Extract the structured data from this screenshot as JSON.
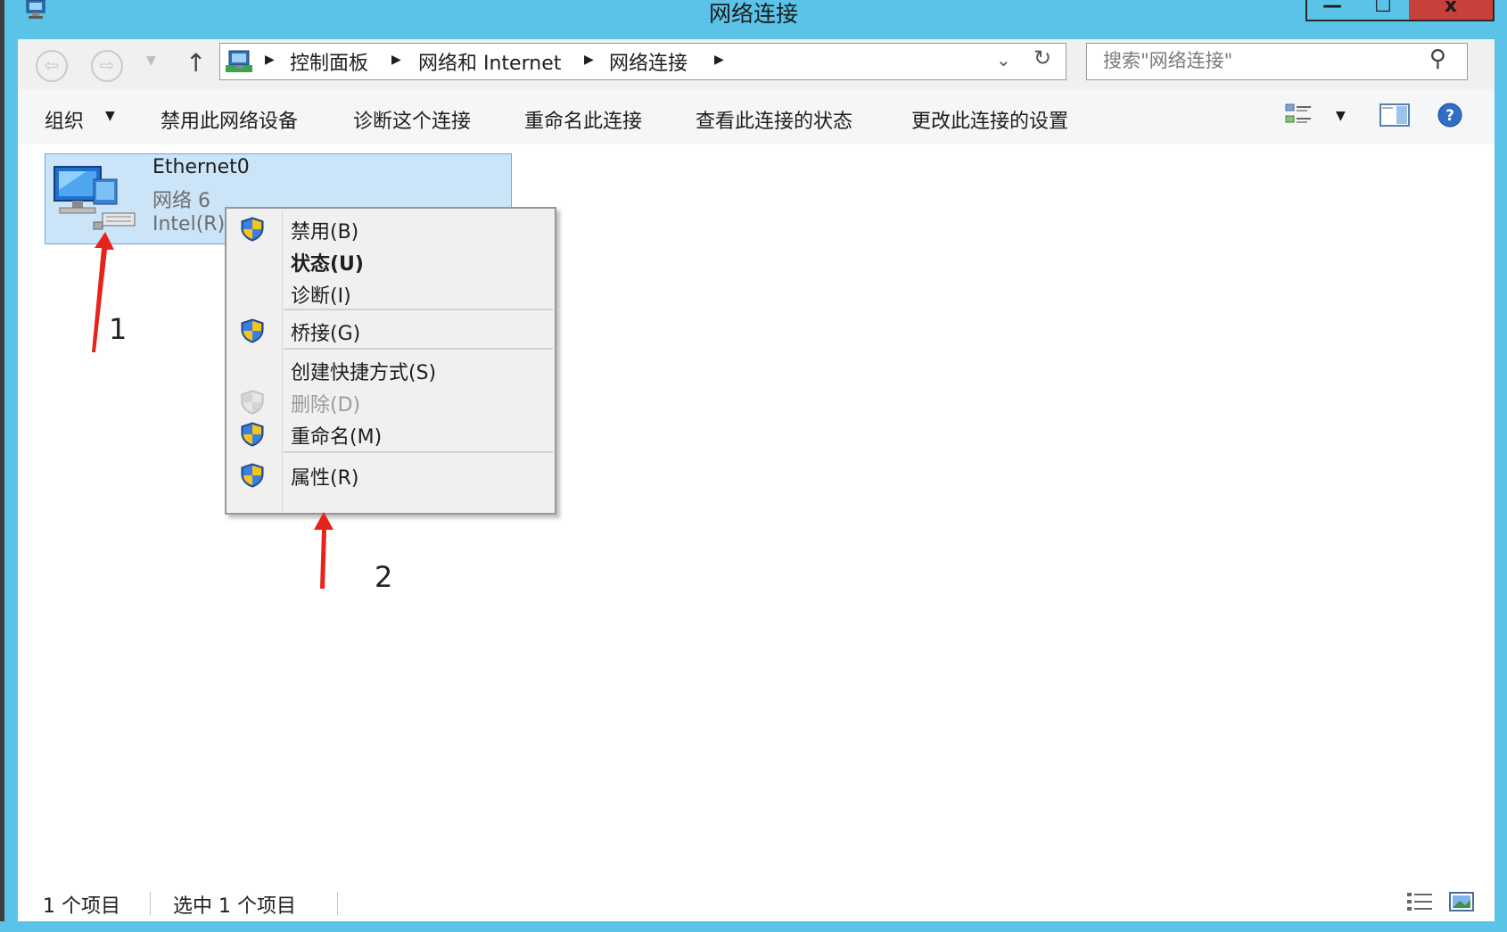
{
  "window": {
    "title": "网络连接",
    "controls": {
      "minimize": "—",
      "maximize": "☐",
      "close": "x"
    }
  },
  "nav": {
    "back_icon": "arrow-left-icon",
    "forward_icon": "arrow-right-icon",
    "up_symbol": "↑",
    "breadcrumb": [
      "控制面板",
      "网络和 Internet",
      "网络连接"
    ],
    "refresh_symbol": "↻",
    "dropdown_symbol": "⌄"
  },
  "search": {
    "placeholder": "搜索\"网络连接\""
  },
  "toolbar": {
    "organize": "组织",
    "commands": [
      "禁用此网络设备",
      "诊断这个连接",
      "重命名此连接",
      "查看此连接的状态",
      "更改此连接的设置"
    ]
  },
  "connection": {
    "name": "Ethernet0",
    "network": "网络  6",
    "device": "Intel(R)"
  },
  "context_menu": {
    "items": [
      {
        "label": "禁用(B)",
        "shield": true,
        "bold": false,
        "disabled": false
      },
      {
        "label": "状态(U)",
        "shield": false,
        "bold": true,
        "disabled": false
      },
      {
        "label": "诊断(I)",
        "shield": false,
        "bold": false,
        "disabled": false
      },
      {
        "label": "桥接(G)",
        "shield": true,
        "bold": false,
        "disabled": false
      },
      {
        "label": "创建快捷方式(S)",
        "shield": false,
        "bold": false,
        "disabled": false
      },
      {
        "label": "删除(D)",
        "shield": true,
        "bold": false,
        "disabled": true
      },
      {
        "label": "重命名(M)",
        "shield": true,
        "bold": false,
        "disabled": false
      },
      {
        "label": "属性(R)",
        "shield": true,
        "bold": false,
        "disabled": false
      }
    ]
  },
  "annotations": {
    "one": "1",
    "two": "2",
    "color": "#e8231b"
  },
  "status": {
    "items_count": "1 个项目",
    "selected_count": "选中 1 个项目"
  },
  "colors": {
    "frame": "#5bc2e8",
    "selection": "#cce4f7",
    "close": "#c7413a"
  }
}
